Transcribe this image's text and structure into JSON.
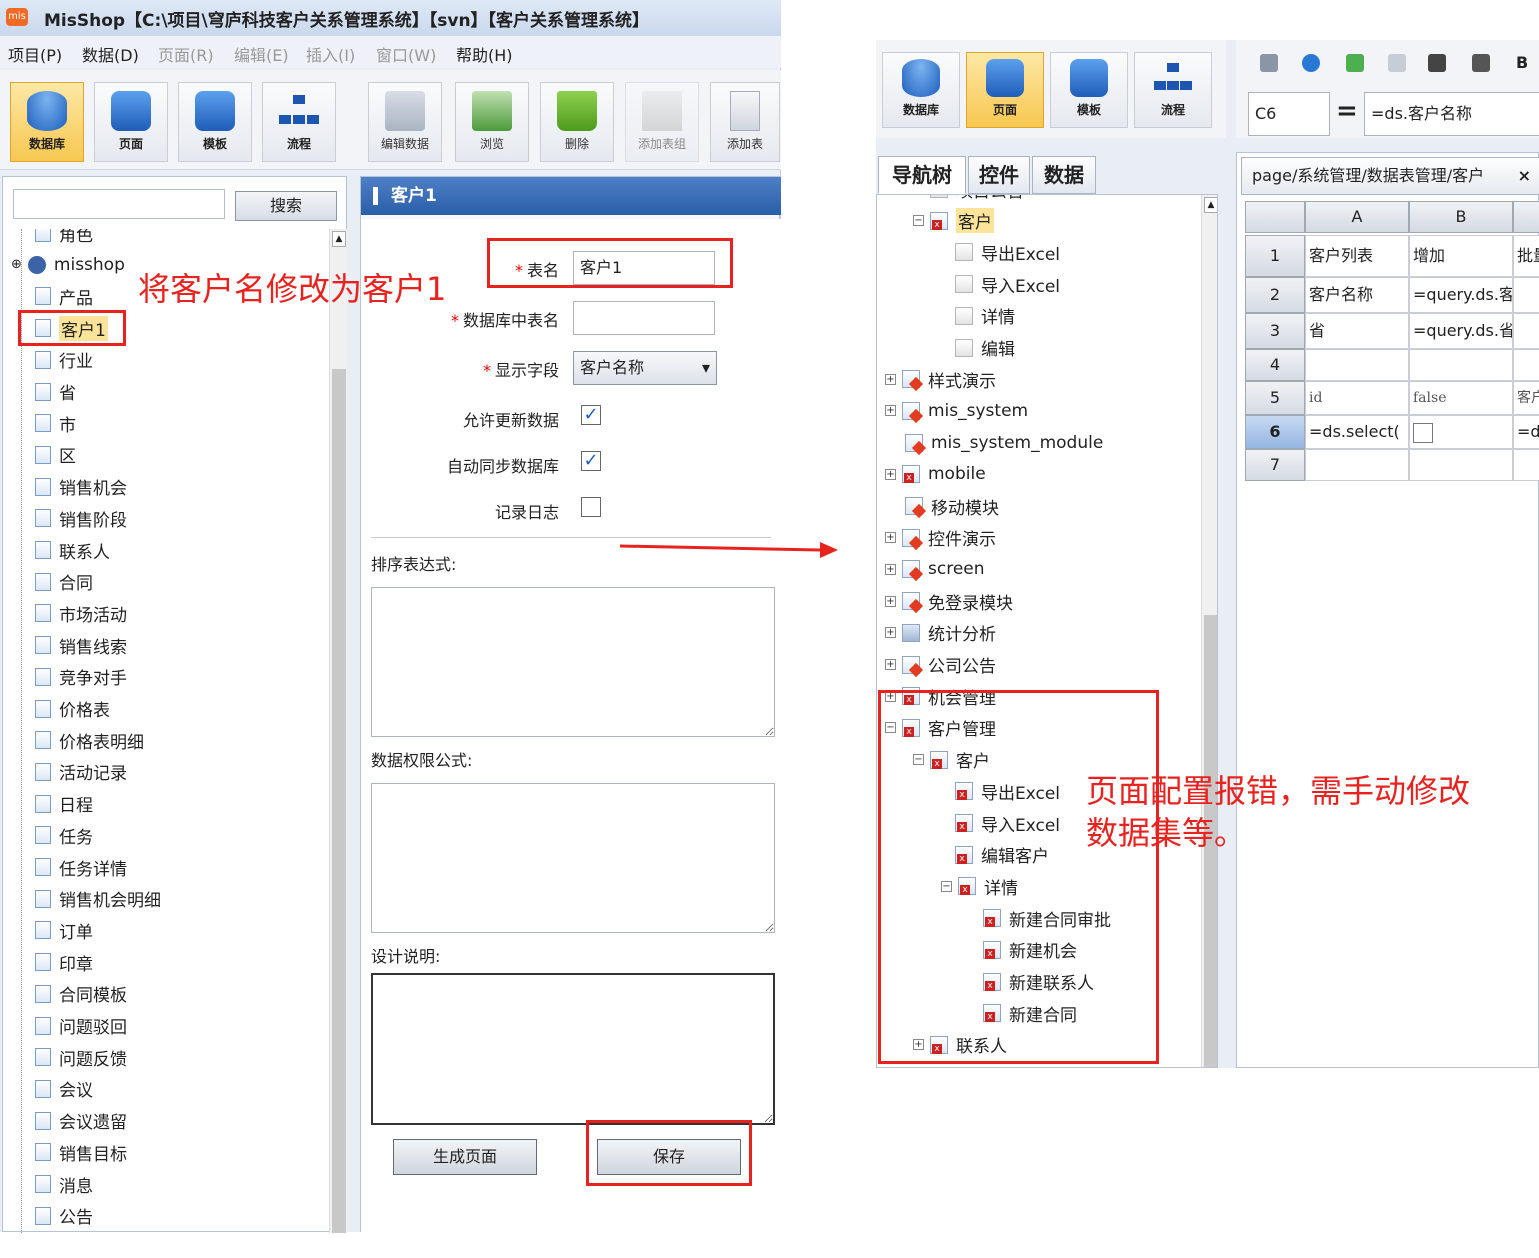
{
  "left_window": {
    "title": "MisShop【C:\\项目\\穹庐科技客户关系管理系统】【svn】【客户关系管理系统】",
    "menu": [
      {
        "label": "项目(P)",
        "enabled": true
      },
      {
        "label": "数据(D)",
        "enabled": true
      },
      {
        "label": "页面(R)",
        "enabled": false
      },
      {
        "label": "编辑(E)",
        "enabled": false
      },
      {
        "label": "插入(I)",
        "enabled": false
      },
      {
        "label": "窗口(W)",
        "enabled": false
      },
      {
        "label": "帮助(H)",
        "enabled": true
      }
    ],
    "toolbar": {
      "database": "数据库",
      "page": "页面",
      "template": "模板",
      "flow": "流程",
      "edit_data": "编辑数据",
      "browse": "浏览",
      "delete": "删除",
      "add_table_group": "添加表组",
      "add_table": "添加表"
    },
    "sidebar": {
      "search_button": "搜索",
      "search_value": "",
      "items": [
        "角色",
        "misshop",
        "产品",
        "客户1",
        "行业",
        "省",
        "市",
        "区",
        "销售机会",
        "销售阶段",
        "联系人",
        "合同",
        "市场活动",
        "销售线索",
        "竞争对手",
        "价格表",
        "价格表明细",
        "活动记录",
        "日程",
        "任务",
        "任务详情",
        "销售机会明细",
        "订单",
        "印章",
        "合同模板",
        "问题驳回",
        "问题反馈",
        "会议",
        "会议遗留",
        "销售目标",
        "消息",
        "公告"
      ],
      "selected": "客户1"
    },
    "panel": {
      "title": "客户1",
      "table_name_label": "表名",
      "table_name_value": "客户1",
      "db_table_label": "数据库中表名",
      "db_table_value": "",
      "display_field_label": "显示字段",
      "display_field_value": "客户名称",
      "allow_update_label": "允许更新数据",
      "allow_update": true,
      "auto_sync_label": "自动同步数据库",
      "auto_sync": true,
      "log_label": "记录日志",
      "log": false,
      "sort_expr_label": "排序表达式:",
      "perm_formula_label": "数据权限公式:",
      "design_note_label": "设计说明:",
      "gen_page_button": "生成页面",
      "save_button": "保存"
    }
  },
  "annotations": {
    "rename_note": "将客户名修改为客户1",
    "error_note_line1": "页面配置报错，需手动修改",
    "error_note_line2": "数据集等。"
  },
  "right_window": {
    "toolbar": {
      "database": "数据库",
      "page": "页面",
      "template": "模板",
      "flow": "流程"
    },
    "cell_name": "C6",
    "formula": "=ds.客户名称",
    "nav_tabs": [
      "导航树",
      "控件",
      "数据"
    ],
    "tree": [
      {
        "label": "项目公告",
        "level": 2,
        "expander": "⊖",
        "icon": "grey"
      },
      {
        "label": "客户",
        "level": 2,
        "expander": "⊖",
        "icon": "red",
        "highlight": true
      },
      {
        "label": "导出Excel",
        "level": 3,
        "icon": "grey"
      },
      {
        "label": "导入Excel",
        "level": 3,
        "icon": "grey"
      },
      {
        "label": "详情",
        "level": 3,
        "icon": "grey"
      },
      {
        "label": "编辑",
        "level": 3,
        "icon": "grey"
      },
      {
        "label": "样式演示",
        "level": 1,
        "expander": "⊕",
        "icon": "pen"
      },
      {
        "label": "mis_system",
        "level": 1,
        "expander": "⊕",
        "icon": "pen"
      },
      {
        "label": "mis_system_module",
        "level": 1,
        "icon": "pen"
      },
      {
        "label": "mobile",
        "level": 1,
        "expander": "⊕",
        "icon": "red"
      },
      {
        "label": "移动模块",
        "level": 1,
        "icon": "pen"
      },
      {
        "label": "控件演示",
        "level": 1,
        "expander": "⊕",
        "icon": "pen"
      },
      {
        "label": "screen",
        "level": 1,
        "expander": "⊕",
        "icon": "pen"
      },
      {
        "label": "免登录模块",
        "level": 1,
        "expander": "⊕",
        "icon": "pen"
      },
      {
        "label": "统计分析",
        "level": 1,
        "expander": "⊕",
        "icon": "stat"
      },
      {
        "label": "公司公告",
        "level": 1,
        "expander": "⊕",
        "icon": "pen"
      },
      {
        "label": "机会管理",
        "level": 1,
        "expander": "⊕",
        "icon": "red"
      },
      {
        "label": "客户管理",
        "level": 1,
        "expander": "⊖",
        "icon": "red"
      },
      {
        "label": "客户",
        "level": 2,
        "expander": "⊖",
        "icon": "red"
      },
      {
        "label": "导出Excel",
        "level": 3,
        "icon": "red"
      },
      {
        "label": "导入Excel",
        "level": 3,
        "icon": "red"
      },
      {
        "label": "编辑客户",
        "level": 3,
        "icon": "red"
      },
      {
        "label": "详情",
        "level": 3,
        "expander": "⊖",
        "icon": "red"
      },
      {
        "label": "新建合同审批",
        "level": 4,
        "icon": "red"
      },
      {
        "label": "新建机会",
        "level": 4,
        "icon": "red"
      },
      {
        "label": "新建联系人",
        "level": 4,
        "icon": "red"
      },
      {
        "label": "新建合同",
        "level": 4,
        "icon": "red"
      },
      {
        "label": "联系人",
        "level": 2,
        "expander": "⊕",
        "icon": "red"
      }
    ],
    "sheet_tab": "page/系统管理/数据表管理/客户",
    "sheet_close": "×",
    "columns": [
      "A",
      "B"
    ],
    "rows": [
      {
        "num": "1",
        "cells": [
          "客户列表",
          "增加",
          "批量"
        ]
      },
      {
        "num": "2",
        "cells": [
          "客户名称",
          "=query.ds.客户名",
          ""
        ]
      },
      {
        "num": "3",
        "cells": [
          "省",
          "=query.ds.省",
          ""
        ]
      },
      {
        "num": "4",
        "cells": [
          "",
          "",
          ""
        ]
      },
      {
        "num": "5",
        "cells": [
          "id",
          "false",
          "客户"
        ]
      },
      {
        "num": "6",
        "cells": [
          "=ds.select(",
          "",
          "=ds"
        ]
      },
      {
        "num": "7",
        "cells": [
          "",
          "",
          ""
        ]
      }
    ]
  }
}
